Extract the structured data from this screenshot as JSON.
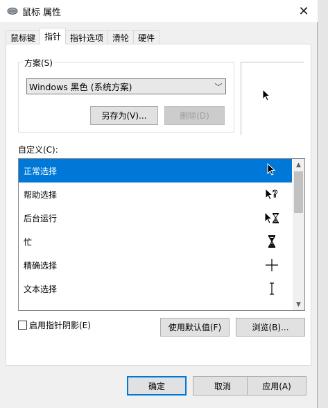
{
  "window": {
    "title": "鼠标 属性",
    "close": "✕"
  },
  "tabs": [
    {
      "label": "鼠标键"
    },
    {
      "label": "指针"
    },
    {
      "label": "指针选项"
    },
    {
      "label": "滑轮"
    },
    {
      "label": "硬件"
    }
  ],
  "scheme": {
    "group_label": "方案(S)",
    "selected": "Windows 黑色 (系统方案)",
    "save_as": "另存为(V)...",
    "delete": "删除(D)"
  },
  "custom": {
    "label": "自定义(C):",
    "rows": [
      {
        "label": "正常选择",
        "icon": "arrow-cursor-icon"
      },
      {
        "label": "帮助选择",
        "icon": "help-cursor-icon"
      },
      {
        "label": "后台运行",
        "icon": "working-cursor-icon"
      },
      {
        "label": "忙",
        "icon": "hourglass-cursor-icon"
      },
      {
        "label": "精确选择",
        "icon": "crosshair-cursor-icon"
      },
      {
        "label": "文本选择",
        "icon": "ibeam-cursor-icon"
      }
    ]
  },
  "shadow": {
    "label": "启用指针阴影(E)"
  },
  "actions": {
    "use_default": "使用默认值(F)",
    "browse": "浏览(B)...",
    "ok": "确定",
    "cancel": "取消",
    "apply": "应用(A)"
  },
  "colors": {
    "accent": "#0078d7",
    "selection": "#0078d7"
  }
}
